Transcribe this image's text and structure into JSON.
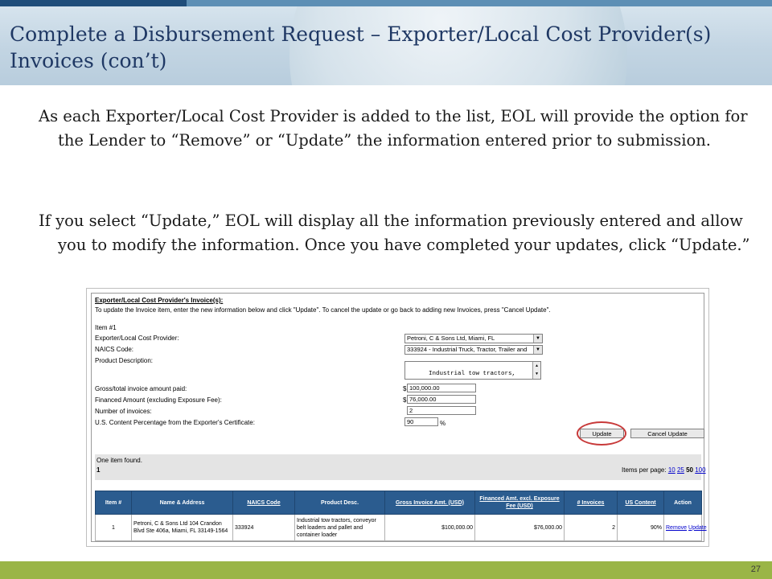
{
  "slide": {
    "title": "Complete a Disbursement Request – Exporter/Local Cost Provider(s) Invoices (con’t)",
    "paragraph1": "As each Exporter/Local Cost Provider is added to the list, EOL will provide the option for the Lender to “Remove” or “Update” the information entered prior to submission.",
    "paragraph2": "If you select “Update,” EOL will display all the information previously entered and allow you to modify the information.  Once you have completed your updates, click “Update.”",
    "page_number": "27"
  },
  "form": {
    "section_title": "Exporter/Local Cost Provider's Invoice(s):",
    "instruction": "To update the Invoice item, enter the new information below and click \"Update\". To cancel the update or go back to adding new Invoices, press \"Cancel Update\".",
    "item_label": "Item #1",
    "provider_label": "Exporter/Local Cost Provider:",
    "provider_value": "Petroni, C & Sons Ltd, Miami, FL",
    "naics_label": "NAICS Code:",
    "naics_value": "333924 - Industrial Truck, Tractor, Trailer and",
    "description_label": "Product Description:",
    "description_value": "Industrial tow tractors,\nconveyor belt loaders and",
    "gross_label": "Gross/total invoice amount paid:",
    "gross_value": "100,000.00",
    "financed_label": "Financed Amount (excluding Exposure Fee):",
    "financed_value": "76,000.00",
    "invoices_label": "Number of invoices:",
    "invoices_value": "2",
    "content_label": "U.S. Content Percentage from the Exporter's Certificate:",
    "content_value": "90",
    "currency_symbol": "$",
    "percent_symbol": "%",
    "update_button": "Update",
    "cancel_button": "Cancel Update"
  },
  "results": {
    "found_text": "One item found.",
    "page": "1",
    "per_page_label": "Items per page:",
    "per_page_options": [
      "10",
      "25",
      "50",
      "100"
    ],
    "columns": [
      "Item #",
      "Name & Address",
      "NAICS Code",
      "Product Desc.",
      "Gross Invoice Amt. (USD)",
      "Financed Amt. excl. Exposure Fee (USD)",
      "# Invoices",
      "US Content",
      "Action"
    ],
    "rows": [
      {
        "item": "1",
        "name_address": "Petroni, C & Sons Ltd 104 Crandon Blvd Ste 406a, Miami, FL 33149-1564",
        "naics": "333924",
        "product": "Industrial tow tractors, conveyor belt loaders and pallet and container loader",
        "gross": "$100,000.00",
        "financed": "$76,000.00",
        "invoices": "2",
        "us_content": "90%",
        "remove": "Remove",
        "update": "Update"
      }
    ]
  },
  "colors": {
    "title_text": "#1f3864",
    "table_header": "#2b5c8f",
    "footer_bar": "#9ab547",
    "highlight_circle": "#c83a3a",
    "link": "#0000cc"
  }
}
